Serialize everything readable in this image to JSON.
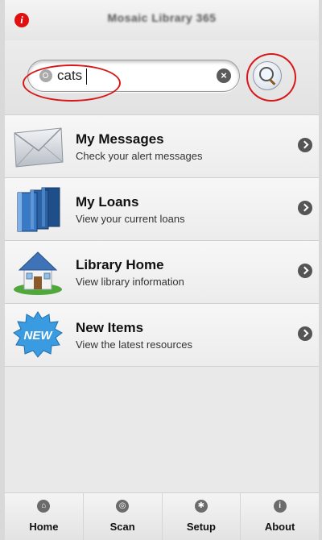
{
  "header": {
    "title": "Mosaic Library 365"
  },
  "search": {
    "value": "cats",
    "placeholder": ""
  },
  "menu": {
    "items": [
      {
        "title": "My Messages",
        "subtitle": "Check your alert messages",
        "icon": "envelope-icon"
      },
      {
        "title": "My Loans",
        "subtitle": "View your current loans",
        "icon": "books-icon"
      },
      {
        "title": "Library Home",
        "subtitle": "View library information",
        "icon": "house-icon"
      },
      {
        "title": "New Items",
        "subtitle": "View the latest resources",
        "icon": "new-badge-icon",
        "badge": "NEW"
      }
    ]
  },
  "tabs": [
    {
      "label": "Home",
      "icon": "home-icon"
    },
    {
      "label": "Scan",
      "icon": "scan-icon"
    },
    {
      "label": "Setup",
      "icon": "gear-icon"
    },
    {
      "label": "About",
      "icon": "info-icon"
    }
  ],
  "colors": {
    "annotation": "#d81818",
    "accent": "#2f6fb3",
    "info_badge": "#e01010"
  }
}
